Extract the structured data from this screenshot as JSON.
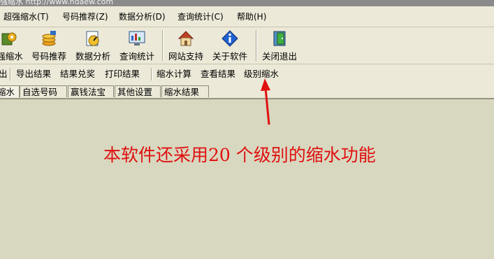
{
  "window": {
    "title_fragment": "强缩水 http://www.ndaew.com"
  },
  "menu": {
    "items": [
      {
        "label": "超强缩水(T)"
      },
      {
        "label": "号码推荐(Z)"
      },
      {
        "label": "数据分析(D)"
      },
      {
        "label": "查询统计(C)"
      },
      {
        "label": "帮助(H)"
      }
    ]
  },
  "toolbar": {
    "buttons": [
      {
        "label": "强缩水",
        "icon": "gear-icon"
      },
      {
        "label": "号码推荐",
        "icon": "coins-icon"
      },
      {
        "label": "数据分析",
        "icon": "chart-dial-icon"
      },
      {
        "label": "查询统计",
        "icon": "monitor-icon"
      },
      {
        "label": "网站支持",
        "icon": "home-icon"
      },
      {
        "label": "关于软件",
        "icon": "info-icon"
      },
      {
        "label": "关闭退出",
        "icon": "exit-door-icon"
      }
    ]
  },
  "subbar": {
    "items": [
      {
        "label": "出"
      },
      {
        "label": "导出结果"
      },
      {
        "label": "结果兑奖"
      },
      {
        "label": "打印结果"
      },
      {
        "label": "缩水计算"
      },
      {
        "label": "查看结果"
      },
      {
        "label": "级别缩水"
      }
    ]
  },
  "tabs": {
    "items": [
      {
        "label": "缩水"
      },
      {
        "label": "自选号码"
      },
      {
        "label": "赢钱法宝"
      },
      {
        "label": "其他设置"
      },
      {
        "label": "缩水结果"
      }
    ]
  },
  "annotation": {
    "text": "本软件还采用20 个级别的缩水功能",
    "color": "#e01010"
  },
  "colors": {
    "background": "#d8d8c0",
    "toolbar": "#ece9d8"
  }
}
